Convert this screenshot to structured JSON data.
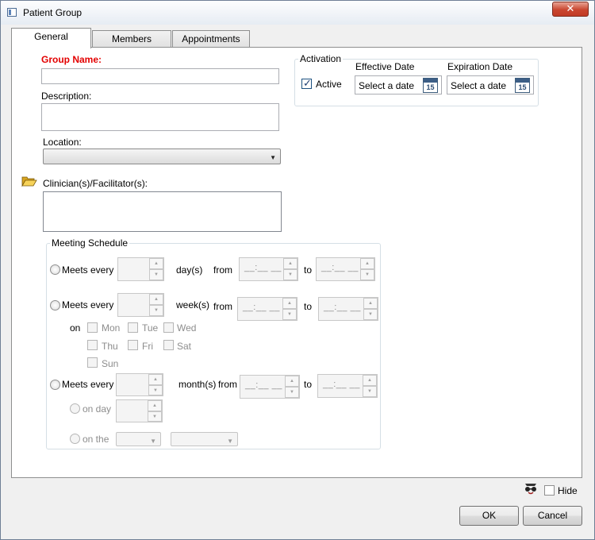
{
  "window": {
    "title": "Patient Group",
    "close_glyph": "✕"
  },
  "tabs": [
    {
      "label": "General",
      "active": true
    },
    {
      "label": "Members",
      "active": false
    },
    {
      "label": "Appointments",
      "active": false
    }
  ],
  "general": {
    "group_name_label": "Group Name:",
    "group_name_value": "",
    "description_label": "Description:",
    "description_value": "",
    "location_label": "Location:",
    "location_value": "",
    "clinicians_label": "Clinician(s)/Facilitator(s):",
    "clinicians_icon": "open-folder-icon"
  },
  "activation": {
    "label": "Activation",
    "active_label": "Active",
    "active_checked": true,
    "effective_date_label": "Effective Date",
    "effective_date_placeholder": "Select a date",
    "expiration_date_label": "Expiration Date",
    "expiration_date_placeholder": "Select a date",
    "calendar_day": "15"
  },
  "meeting_schedule": {
    "label": "Meeting Schedule",
    "time_placeholder": "__:__ __",
    "from_label": "from",
    "to_label": "to",
    "rows": [
      {
        "label": "Meets every",
        "unit": "day(s)"
      },
      {
        "label": "Meets every",
        "unit": "week(s)"
      },
      {
        "label": "Meets every",
        "unit": "month(s)"
      }
    ],
    "on_label": "on",
    "weekdays": [
      "Mon",
      "Tue",
      "Wed",
      "Thu",
      "Fri",
      "Sat",
      "Sun"
    ],
    "on_day_label": "on day",
    "on_the_label": "on the"
  },
  "footer": {
    "hide_label": "Hide",
    "hide_icon": "spy-glasses-icon",
    "ok_label": "OK",
    "cancel_label": "Cancel"
  },
  "colors": {
    "required_label": "#e30000",
    "close_button": "#c9462f",
    "panel_background": "#ffffff",
    "window_background": "#f0f0f0"
  }
}
